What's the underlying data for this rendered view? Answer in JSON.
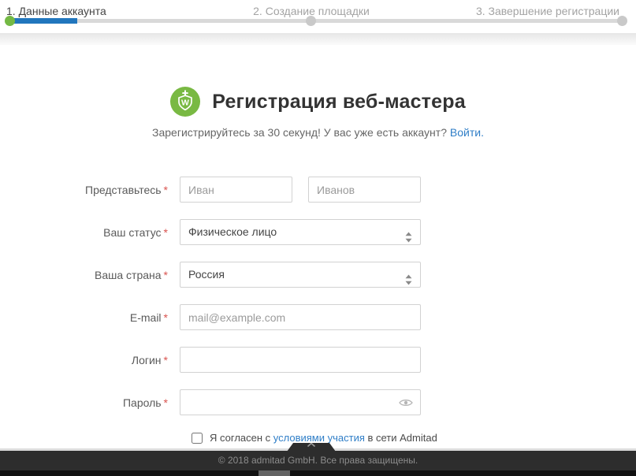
{
  "steps": {
    "items": [
      {
        "label": "1. Данные аккаунта",
        "active": true
      },
      {
        "label": "2. Создание площадки",
        "active": false
      },
      {
        "label": "3. Завершение регистрации",
        "active": false
      }
    ],
    "progress_percent": 11
  },
  "colors": {
    "progress_fill": "#2176bd",
    "progress_track": "#d9d9d9",
    "active_step_dot": "#74b944",
    "logo_green": "#79b943",
    "link_blue": "#2f7ec7",
    "footer_bg": "#2d2d2d",
    "required_red": "#d9534f"
  },
  "header": {
    "title": "Регистрация веб-мастера",
    "subtitle_text": "Зарегистрируйтесь за 30 секунд! У вас уже есть аккаунт? ",
    "subtitle_link": "Войти."
  },
  "form": {
    "required_marker": "*",
    "name_row": {
      "label": "Представьтесь",
      "first_name_placeholder": "Иван",
      "last_name_placeholder": "Иванов"
    },
    "status_row": {
      "label": "Ваш статус",
      "value": "Физическое лицо"
    },
    "country_row": {
      "label": "Ваша страна",
      "value": "Россия"
    },
    "email_row": {
      "label": "E-mail",
      "placeholder": "mail@example.com"
    },
    "login_row": {
      "label": "Логин",
      "placeholder": ""
    },
    "password_row": {
      "label": "Пароль",
      "placeholder": ""
    },
    "agreement": {
      "prefix": "Я согласен с ",
      "link": "условиями участия",
      "suffix": " в сети Admitad",
      "checked": false
    }
  },
  "footer": {
    "copyright": "© 2018 admitad GmbH. Все права защищены."
  }
}
